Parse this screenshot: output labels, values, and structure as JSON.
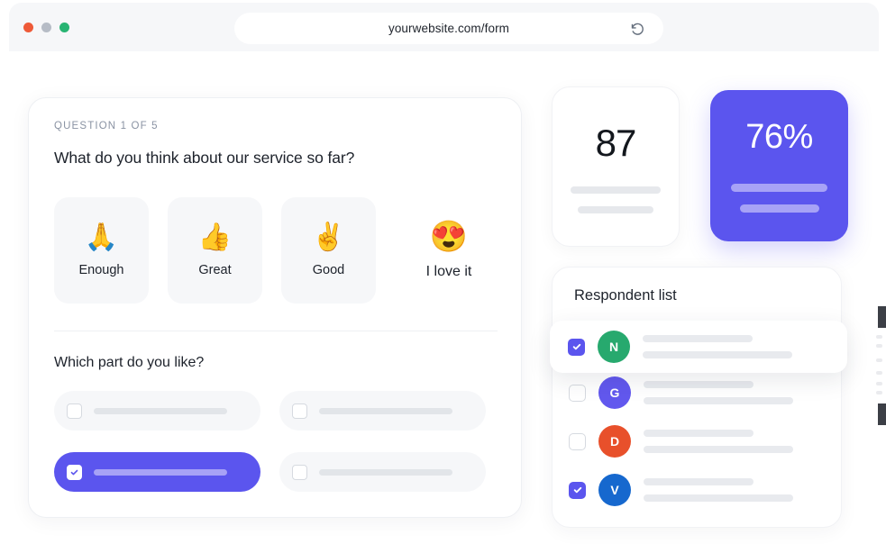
{
  "browser": {
    "url": "yourwebsite.com/form",
    "reload_icon": "reload-icon",
    "traffic_lights": [
      "red",
      "gray",
      "green"
    ]
  },
  "colors": {
    "accent_purple": "#5B55EE",
    "accent_purple_light": "#A7A2F6",
    "page_background": "#FFFFFF",
    "tile_gray": "#F6F7F9",
    "skeleton_gray": "#E6E8EC",
    "text_dark": "#1D222B",
    "text_muted": "#8A93A3"
  },
  "question_card": {
    "eyebrow": "QUESTION 1 OF 5",
    "title": "What do you think about our service so far?",
    "options": [
      {
        "emoji": "🙏",
        "icon_name": "folded-hands-emoji",
        "label": "Enough",
        "style": "tile"
      },
      {
        "emoji": "👍",
        "icon_name": "thumbs-up-emoji",
        "label": "Great",
        "style": "tile"
      },
      {
        "emoji": "✌️",
        "icon_name": "victory-hand-emoji",
        "label": "Good",
        "style": "tile"
      },
      {
        "emoji": "😍",
        "icon_name": "smiling-face-with-hearts-emoji",
        "label": "I love it",
        "style": "plain"
      }
    ],
    "subquestion_title": "Which part do you like?",
    "checkbox_options": [
      {
        "selected": false
      },
      {
        "selected": false
      },
      {
        "selected": true
      },
      {
        "selected": false
      }
    ]
  },
  "stats": [
    {
      "value": "87",
      "style": "white"
    },
    {
      "value": "76%",
      "style": "purple"
    }
  ],
  "respondents": {
    "title": "Respondent list",
    "rows": [
      {
        "initial": "N",
        "color": "#27A96E",
        "checked": true
      },
      {
        "initial": "G",
        "color": "#6258EE",
        "checked": false
      },
      {
        "initial": "D",
        "color": "#E8502B",
        "checked": false
      },
      {
        "initial": "V",
        "color": "#1668CE",
        "checked": true
      }
    ],
    "highlighted_row": {
      "initial": "N",
      "color": "#27A96E",
      "checked": true
    }
  }
}
